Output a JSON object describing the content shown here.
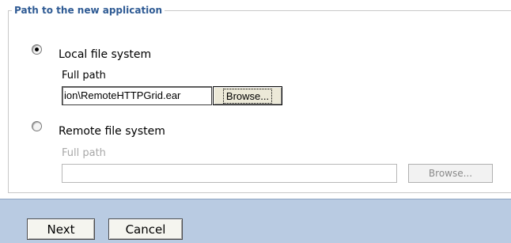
{
  "section": {
    "title": "Path to the new application"
  },
  "local": {
    "label": "Local file system",
    "selected": true,
    "path_label": "Full path",
    "path_value": "ion\\RemoteHTTPGrid.ear",
    "browse_label": "Browse..."
  },
  "remote": {
    "label": "Remote file system",
    "selected": false,
    "path_label": "Full path",
    "path_value": "",
    "browse_label": "Browse..."
  },
  "footer": {
    "next_label": "Next",
    "cancel_label": "Cancel"
  },
  "colors": {
    "legend": "#2f5b94",
    "footer_bg": "#b9cbe2"
  }
}
